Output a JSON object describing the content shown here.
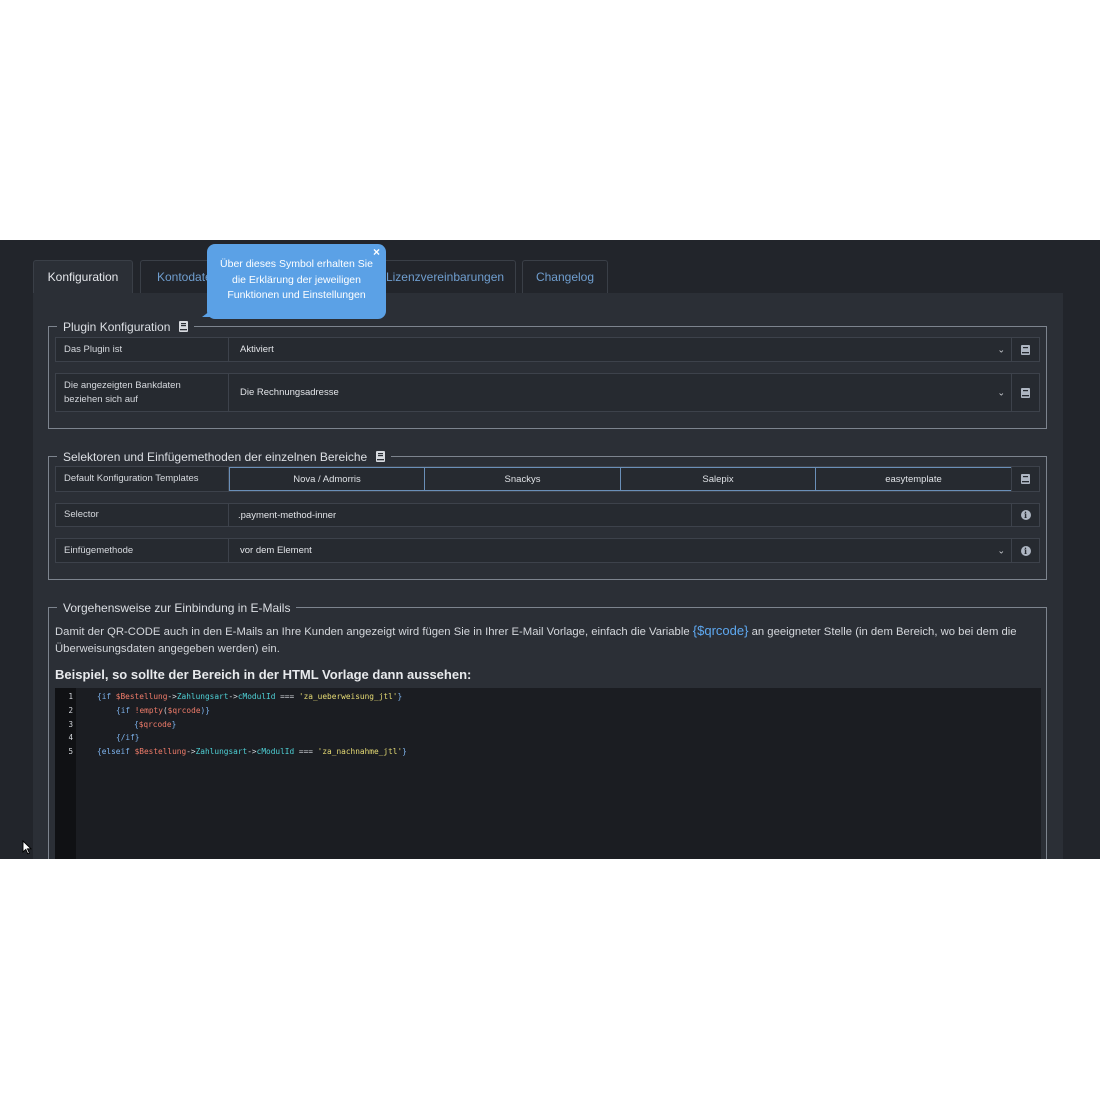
{
  "tabs": [
    {
      "label": "Konfiguration",
      "active": true
    },
    {
      "label": "Kontodate"
    },
    {
      "label": "Lizenzvereinbarungen"
    },
    {
      "label": "Changelog"
    }
  ],
  "tooltip": {
    "text": "Über dieses Symbol erhalten Sie die Erklärung der jeweiligen Funktionen und Einstellungen",
    "close": "×"
  },
  "plugin_config": {
    "legend": "Plugin Konfiguration",
    "rows": [
      {
        "label": "Das Plugin ist",
        "value": "Aktiviert"
      },
      {
        "label": "Die angezeigten Bankdaten beziehen sich auf",
        "value": "Die Rechnungsadresse"
      }
    ]
  },
  "selectors": {
    "legend": "Selektoren und Einfügemethoden der einzelnen Bereiche",
    "templates_label": "Default Konfiguration Templates",
    "templates": [
      "Nova / Admorris",
      "Snackys",
      "Salepix",
      "easytemplate"
    ],
    "selector_label": "Selector",
    "selector_value": ".payment-method-inner",
    "method_label": "Einfügemethode",
    "method_value": "vor dem Element"
  },
  "email": {
    "legend": "Vorgehensweise zur Einbindung in E-Mails",
    "para_before": "Damit der QR-CODE auch in den E-Mails an Ihre Kunden angezeigt wird fügen Sie in Ihrer E-Mail Vorlage, einfach die Variable",
    "variable": "{$qrcode}",
    "para_after": "an geeigneter Stelle (in dem Bereich, wo bei dem die Überweisungsdaten angegeben werden) ein.",
    "example_heading": "Beispiel, so sollte der Bereich in der HTML Vorlage dann aussehen:"
  },
  "code": {
    "line_numbers": [
      "1",
      "2",
      "3",
      "4",
      "5"
    ],
    "l1": {
      "a": "{if ",
      "b": "$Bestellung",
      "c": "->",
      "d": "Zahlungsart",
      "e": "->",
      "f": "cModulId",
      "g": " === ",
      "h": "'za_ueberweisung_jtl'",
      "i": "}"
    },
    "l2": {
      "a": "{if ",
      "b": "!empty",
      "c": "(",
      "d": "$qrcode",
      "e": ")}"
    },
    "l3": {
      "a": "{",
      "b": "$qrcode",
      "c": "}"
    },
    "l4": {
      "a": "{/if}"
    },
    "l5": {
      "a": "{elseif ",
      "b": "$Bestellung",
      "c": "->",
      "d": "Zahlungsart",
      "e": "->",
      "f": "cModulId",
      "g": " === ",
      "h": "'za_nachnahme_jtl'",
      "i": "}"
    }
  },
  "icons": {
    "book": "book-icon",
    "info": "info-icon",
    "chevron": "chevron-down-icon",
    "cursor": "mouse-cursor"
  },
  "colors": {
    "accent": "#5ba1e6",
    "background": "#22252b",
    "panel": "#2b2f36"
  }
}
